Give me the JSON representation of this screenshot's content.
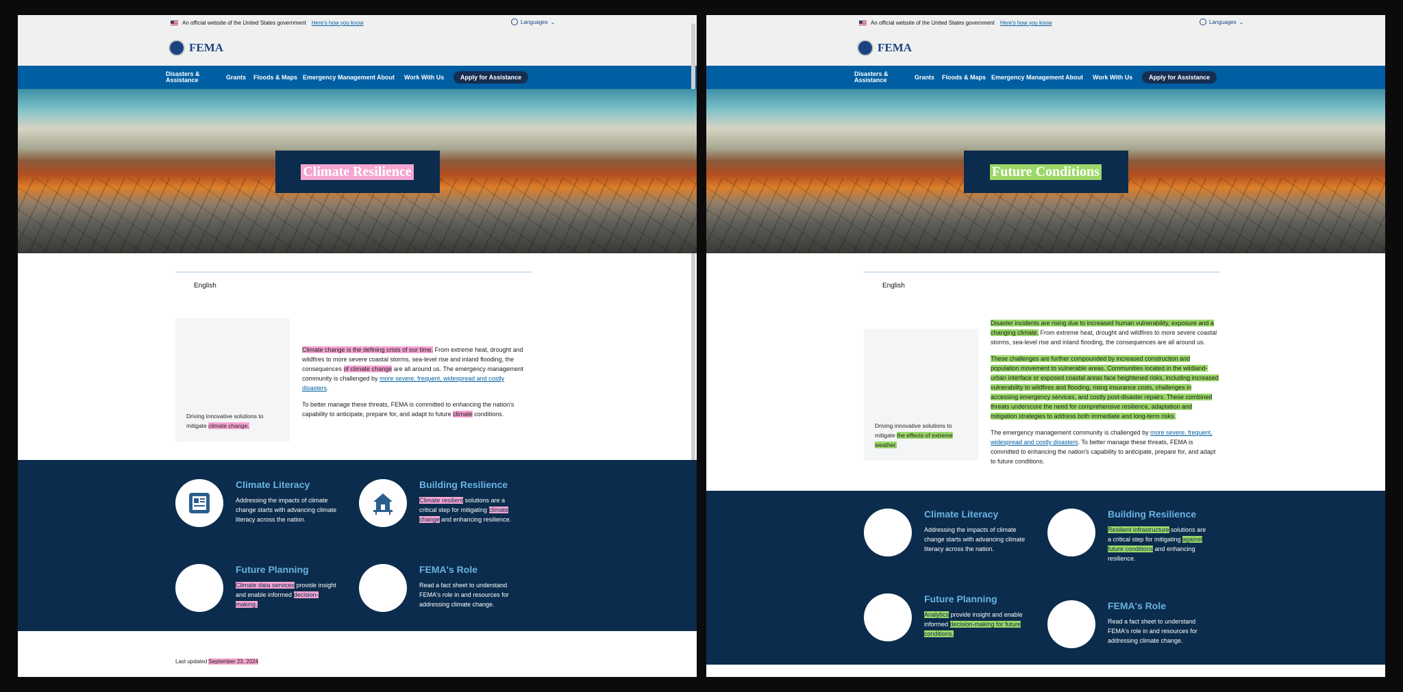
{
  "common": {
    "gov_banner": "An official website of the United States government",
    "gov_link": "Here's how you know",
    "languages": "Languages",
    "logo": "FEMA",
    "nav": {
      "disasters": "Disasters & Assistance",
      "grants": "Grants",
      "floods": "Floods & Maps",
      "emergency": "Emergency Management",
      "about": "About",
      "workwith": "Work With Us",
      "apply": "Apply for Assistance"
    },
    "english": "English"
  },
  "left": {
    "hero_title": "Climate Resilience",
    "side_pre": "Driving innovative solutions to mitigate ",
    "side_hl": "climate change.",
    "p1_hl1": "Climate change is the defining crisis of our time.",
    "p1_mid1": " From extreme heat, drought and wildfires to more severe coastal storms, sea-level rise and inland flooding, the consequences ",
    "p1_hl2": "of climate change",
    "p1_mid2": " are all around us. The emergency management community is challenged by ",
    "p1_link": "more severe, frequent, widespread and costly disasters",
    "p1_end": ".",
    "p2_pre": "To better manage these threats, FEMA is committed to enhancing the nation's capability to anticipate, prepare for, and adapt to future ",
    "p2_hl": "climate",
    "p2_end": " conditions.",
    "tiles": {
      "t1_title": "Climate Literacy",
      "t1_text": "Addressing the impacts of climate change starts with advancing climate literacy across the nation.",
      "t2_title": "Building Resilience",
      "t2_hl1": "Climate resilient",
      "t2_mid": " solutions are a critical step for mitigating ",
      "t2_hl2": "climate change",
      "t2_end": " and enhancing resilience.",
      "t3_title": "Future Planning",
      "t3_hl1": "Climate data services",
      "t3_mid": " provide insight and enable informed ",
      "t3_hl2": "decision-making.",
      "t4_title": "FEMA's Role",
      "t4_text": "Read a fact sheet to understand FEMA's role in and resources for addressing climate change."
    },
    "updated_pre": "Last updated ",
    "updated_hl": "September 23, 2024"
  },
  "right": {
    "hero_title": "Future Conditions",
    "side_pre": "Driving innovative solutions to mitigate ",
    "side_hl": "the effects of extreme weather.",
    "p1_hl": "Disaster incidents are rising due to increased human vulnerability, exposure and a changing climate.",
    "p1_rest": " From extreme heat, drought and wildfires to more severe coastal storms, sea-level rise and inland flooding, the consequences  are all around us.",
    "p2_hl": "These challenges are further compounded by increased construction and population movement to vulnerable areas. Communities located in the wildland-urban interface or exposed coastal areas face heightened risks, including increased vulnerability to wildfires and flooding, rising insurance costs, challenges in accessing emergency services, and costly post-disaster repairs. These combined threats underscore the need for comprehensive resilience, adaptation and mitigation strategies to address both immediate and long-term risks.",
    "p3_pre": "The emergency management community is challenged by ",
    "p3_link": "more severe, frequent, widespread and costly disasters",
    "p3_rest": ". To better manage these threats, FEMA is committed to enhancing the nation's capability to anticipate, prepare for, and adapt to future conditions.",
    "tiles": {
      "t1_title": "Climate Literacy",
      "t1_text": "Addressing the impacts of climate change starts with advancing climate literacy across the nation.",
      "t2_title": "Building Resilience",
      "t2_hl1": "Resilient infrastructure",
      "t2_mid": " solutions are a critical step for mitigating ",
      "t2_hl2": "against future conditions",
      "t2_end": " and enhancing resilience.",
      "t3_title": "Future Planning",
      "t3_hl1": "Analytics",
      "t3_mid": " provide insight and enable informed ",
      "t3_hl2": "decision-making for future conditions.",
      "t4_title": "FEMA's Role",
      "t4_text": "Read a fact sheet to understand FEMA's role in and resources for addressing climate change."
    }
  },
  "colors": {
    "nav": "#005ea2",
    "navy": "#0b2c4c",
    "pink_highlight": "#f5a5d2",
    "green_highlight": "#9bd868",
    "tile_title": "#6ab3e4"
  }
}
